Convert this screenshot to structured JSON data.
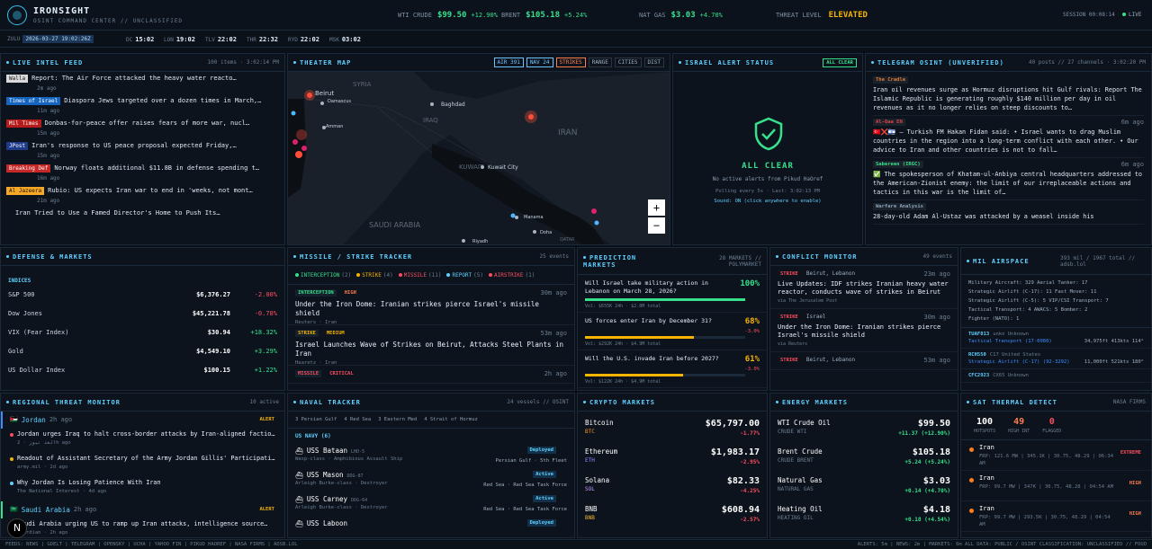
{
  "header": {
    "brand": "IRONSIGHT",
    "subtitle": "OSINT COMMAND CENTER // UNCLASSIFIED",
    "tickers": [
      {
        "label": "WTI CRUDE",
        "price": "$99.50",
        "chg": "+12.90%"
      },
      {
        "label": "BRENT",
        "price": "$105.18",
        "chg": "+5.24%"
      },
      {
        "label": "NAT GAS",
        "price": "$3.03",
        "chg": "+4.70%"
      }
    ],
    "threat_label": "THREAT LEVEL",
    "threat_value": "ELEVATED",
    "session": "SESSION 00:08:14",
    "live": "LIVE"
  },
  "clocks": {
    "zulu_label": "ZULU",
    "zulu": "2026-03-27 19:02:26Z",
    "items": [
      {
        "c": "DC",
        "t": "15:02"
      },
      {
        "c": "LON",
        "t": "19:02"
      },
      {
        "c": "TLV",
        "t": "22:02"
      },
      {
        "c": "THR",
        "t": "22:32"
      },
      {
        "c": "RYD",
        "t": "22:02"
      },
      {
        "c": "MSK",
        "t": "03:02"
      }
    ]
  },
  "feed": {
    "title": "LIVE INTEL FEED",
    "meta": "100 items · 3:02:14 PM",
    "items": [
      {
        "src": "Walla",
        "color": "#d9d9d9",
        "fg": "#111",
        "title": "Report: The Air Force attacked the heavy water reactor in A…",
        "time": "2m ago"
      },
      {
        "src": "Times of Israel",
        "color": "#1565c0",
        "fg": "#fff",
        "title": "Diaspora Jews targeted over a dozen times in March,…",
        "time": "11m ago"
      },
      {
        "src": "Mil Times",
        "color": "#b71c1c",
        "fg": "#fff",
        "title": "Donbas-for-peace offer raises fears of more war, nuclear…",
        "time": "15m ago"
      },
      {
        "src": "JPost",
        "color": "#1e3a8a",
        "fg": "#fff",
        "title": "Iran's response to US peace proposal expected Friday, sourc…",
        "time": "15m ago"
      },
      {
        "src": "Breaking Def",
        "color": "#c62828",
        "fg": "#fff",
        "title": "Norway floats additional $11.8B in defense spending th…",
        "time": "16m ago"
      },
      {
        "src": "Al Jazeera",
        "color": "#f9a825",
        "fg": "#111",
        "title": "Rubio: US expects Iran war to end in 'weeks, not months'",
        "time": "21m ago"
      },
      {
        "src": "",
        "color": "#0c131d",
        "fg": "#fff",
        "title": "Iran Tried to Use a Famed Director's Home to Push Its War Nar…",
        "time": ""
      }
    ]
  },
  "map": {
    "title": "THEATER MAP",
    "buttons": [
      "AIR 391",
      "NAV 24",
      "STRIKES",
      "RANGE",
      "CITIES",
      "DIST"
    ],
    "labels": [
      "SYRIA",
      "Beirut",
      "Damascus",
      "Amman",
      "Baghdad",
      "IRAQ",
      "IRAN",
      "KUWAIT",
      "Kuwait City",
      "SAUDI ARABIA",
      "Manama",
      "Doha",
      "Riyadh",
      "QATAR"
    ]
  },
  "alert": {
    "title": "ISRAEL ALERT STATUS",
    "badge": "ALL CLEAR",
    "status": "ALL CLEAR",
    "sub": "No active alerts from Pikud HaOref",
    "poll": "Polling every 5s · Last: 3:02:13 PM",
    "sound": "Sound: ON (click anywhere to enable)"
  },
  "telegram": {
    "title": "TELEGRAM OSINT (UNVERIFIED)",
    "meta": "40 posts // 27 channels · 3:02:20 PM",
    "items": [
      {
        "ch": "The Cradle",
        "ch_color": "#e37a2f",
        "text": "Iran oil revenues surge as Hormuz disruptions hit Gulf rivals: Report The Islamic Republic is generating roughly $140 million per day in oil revenues as it no longer relies on steep discounts to…",
        "time": ""
      },
      {
        "ch": "Al-Qaa EN",
        "ch_color": "#d84343",
        "text": "🇹🇷❌🇮🇱 — Turkish FM Hakan Fidan said: • Israel wants to drag Muslim countries in the region into a long-term conflict with each other. • Our advice to Iran and other countries is not to fall…",
        "time": "6m ago"
      },
      {
        "ch": "Sabereen (IRGC)",
        "ch_color": "#37e08b",
        "text": "✅ The spokesperson of Khatam-ul-Anbiya central headquarters addressed to the American-Zionist enemy: the limit of our irreplaceable actions and tactics in this war is the limit of…",
        "time": "6m ago"
      },
      {
        "ch": "Warfare Analysis",
        "ch_color": "#8aa1b9",
        "text": "28-day-old Adam Al-Ustaz was attacked by a weasel inside his",
        "time": ""
      }
    ]
  },
  "defense": {
    "title": "DEFENSE & MARKETS",
    "section": "INDICES",
    "rows": [
      {
        "n": "S&P 500",
        "v": "$6,376.27",
        "c": "-2.00%",
        "d": "down"
      },
      {
        "n": "Dow Jones",
        "v": "$45,221.78",
        "c": "-0.78%",
        "d": "down"
      },
      {
        "n": "VIX (Fear Index)",
        "v": "$30.94",
        "c": "+18.32%",
        "d": "up"
      },
      {
        "n": "Gold",
        "v": "$4,549.10",
        "c": "+3.29%",
        "d": "up"
      },
      {
        "n": "US Dollar Index",
        "v": "$100.15",
        "c": "+1.22%",
        "d": "up"
      }
    ]
  },
  "missile": {
    "title": "MISSILE / STRIKE TRACKER",
    "meta": "25 events",
    "chips": [
      {
        "l": "INTERCEPTION",
        "n": "(2)",
        "c": "#37e08b"
      },
      {
        "l": "STRIKE",
        "n": "(4)",
        "c": "#f5b400"
      },
      {
        "l": "MISSILE",
        "n": "(11)",
        "c": "#ff4d5e"
      },
      {
        "l": "REPORT",
        "n": "(5)",
        "c": "#5fd0ff"
      },
      {
        "l": "AIRSTRIKE",
        "n": "(1)",
        "c": "#ff4d5e"
      }
    ],
    "items": [
      {
        "tag": "INTERCEPTION",
        "tc": "#37e08b",
        "lvl": "HIGH",
        "lc": "#ff7d4d",
        "time": "30m ago",
        "title": "Under the Iron Dome: Iranian strikes pierce Israel's missile shield",
        "src": "Reuters · Iran"
      },
      {
        "tag": "STRIKE",
        "tc": "#f5b400",
        "lvl": "MEDIUM",
        "lc": "#f5b400",
        "time": "53m ago",
        "title": "Israel Launches Wave of Strikes on Beirut, Attacks Steel Plants in Iran",
        "src": "Haaretz · Iran"
      },
      {
        "tag": "MISSILE",
        "tc": "#ff4d5e",
        "lvl": "CRITICAL",
        "lc": "#ff4d5e",
        "time": "2h ago",
        "title": "",
        "src": ""
      }
    ]
  },
  "prediction": {
    "title": "PREDICTION MARKETS",
    "meta": "28 MARKETS // POLYMARKET",
    "items": [
      {
        "q": "Will Israel take military action in Lebanon on March 28, 2026?",
        "p": "100%",
        "v": "Vol: $655K 24h · $2.0M total",
        "pct": 100,
        "c": "#37e08b",
        "d": ""
      },
      {
        "q": "US forces enter Iran by December 31?",
        "p": "68%",
        "v": "Vol: $292K 24h · $4.9M total",
        "pct": 68,
        "c": "#f5b400",
        "d": "-3.0%"
      },
      {
        "q": "Will the U.S. invade Iran before 2027?",
        "p": "61%",
        "v": "Vol: $122K 24h · $4.9M total",
        "pct": 61,
        "c": "#f5b400",
        "d": "-3.0%"
      }
    ]
  },
  "conflict": {
    "title": "CONFLICT MONITOR",
    "meta": "49 events",
    "items": [
      {
        "tag": "STRIKE",
        "loc": "Beirut, Lebanon",
        "time": "23m ago",
        "title": "Live Updates: IDF strikes Iranian heavy water reactor, conducts wave of strikes in Beirut",
        "src": "via The Jerusalem Post"
      },
      {
        "tag": "STRIKE",
        "loc": "Israel",
        "time": "30m ago",
        "title": "Under the Iron Dome: Iranian strikes pierce Israel's missile shield",
        "src": "via Reuters"
      },
      {
        "tag": "STRIKE",
        "loc": "Beirut, Lebanon",
        "time": "53m ago",
        "title": "",
        "src": ""
      }
    ]
  },
  "airspace": {
    "title": "MIL AIRSPACE",
    "meta": "393 mil / 1967 total // adsb.lol",
    "lines": [
      "Military Aircraft: 329   Aerial Tanker: 17",
      "Strategic Airlift (C-17): 11   Fast Mover: 11",
      "Strategic Airlift (C-5): 5   VIP/CSI Transport: 7",
      "Tactical Transport: 4   AWACS: 5   Bomber: 2",
      "Fighter (NATO): 1"
    ],
    "flights": [
      {
        "cs": "TUAF813",
        "t": "Tactical Transport (17-0080)",
        "alt": "34,975ft 413kts 114°",
        "ty": "unkn Unknown"
      },
      {
        "cs": "RCH550",
        "t": "Strategic Airlift (C-17) (92-3292)",
        "alt": "11,000ft 521kts 180°",
        "ty": "C17 United States"
      },
      {
        "cs": "CFC2923",
        "t": "",
        "alt": "",
        "ty": "CX65 Unknown"
      }
    ]
  },
  "regional": {
    "title": "REGIONAL THREAT MONITOR",
    "meta": "10 active",
    "groups": [
      {
        "flag": "🇯🇴",
        "country": "Jordan",
        "time": "2h ago",
        "badge": "ALERT",
        "items": [
          {
            "t": "Jordan urges Iraq to halt cross-border attacks by Iran-aligned factions",
            "s": "الغد نيوز · 2h ago",
            "dot": "#ff4d5e"
          },
          {
            "t": "Readout of Assistant Secretary of the Army Jordan Gillis' Participatio…",
            "s": "army.mil · 2d ago",
            "dot": "#f5b400"
          },
          {
            "t": "Why Jordan Is Losing Patience With Iran",
            "s": "The National Interest · 4d ago",
            "dot": "#5fd0ff"
          }
        ]
      },
      {
        "flag": "🇸🇦",
        "country": "Saudi Arabia",
        "time": "2h ago",
        "badge": "ALERT",
        "items": [
          {
            "t": "Saudi Arabia urging US to ramp up Iran attacks, intelligence source…",
            "s": "Guardian · 2h ago",
            "dot": "#ff4d5e"
          }
        ]
      }
    ]
  },
  "naval": {
    "title": "NAVAL TRACKER",
    "meta": "24 vessels // OSINT",
    "filters": [
      "3 Persian Gulf",
      "4 Red Sea",
      "3 Eastern Med",
      "4 Strait of Hormuz"
    ],
    "section": "US NAVY (6)",
    "ships": [
      {
        "n": "USS Bataan",
        "h": "LHD-5",
        "c": "Wasp-class · Amphibious Assault Ship",
        "st": "Deployed",
        "loc": "Persian Gulf · 5th Fleet"
      },
      {
        "n": "USS Mason",
        "h": "DDG-87",
        "c": "Arleigh Burke-class · Destroyer",
        "st": "Active",
        "loc": "Red Sea · Red Sea Task Force"
      },
      {
        "n": "USS Carney",
        "h": "DDG-64",
        "c": "Arleigh Burke-class · Destroyer",
        "st": "Active",
        "loc": "Red Sea · Red Sea Task Force"
      },
      {
        "n": "USS Laboon",
        "h": "",
        "c": "",
        "st": "Deployed",
        "loc": ""
      }
    ]
  },
  "crypto": {
    "title": "CRYPTO MARKETS",
    "rows": [
      {
        "n": "Bitcoin",
        "s": "BTC",
        "p": "$65,797.00",
        "c": "-1.77%"
      },
      {
        "n": "Ethereum",
        "s": "ETH",
        "p": "$1,983.17",
        "c": "-2.95%"
      },
      {
        "n": "Solana",
        "s": "SOL",
        "p": "$82.33",
        "c": "-4.25%"
      },
      {
        "n": "BNB",
        "s": "BNB",
        "p": "$608.94",
        "c": "-2.57%"
      }
    ]
  },
  "energy": {
    "title": "ENERGY MARKETS",
    "rows": [
      {
        "n": "WTI Crude Oil",
        "s": "CRUDE WTI",
        "p": "$99.50",
        "c": "+11.37 (+12.90%)"
      },
      {
        "n": "Brent Crude",
        "s": "CRUDE BRENT",
        "p": "$105.18",
        "c": "+5.24 (+5.24%)"
      },
      {
        "n": "Natural Gas",
        "s": "NATURAL GAS",
        "p": "$3.03",
        "c": "+0.14 (+4.70%)"
      },
      {
        "n": "Heating Oil",
        "s": "HEATING OIL",
        "p": "$4.18",
        "c": "+0.18 (+4.54%)"
      }
    ]
  },
  "thermal": {
    "title": "SAT THERMAL DETECT",
    "meta": "NASA FIRMS",
    "stats": [
      {
        "v": "100",
        "l": "HOTSPOTS",
        "c": "#ffffff"
      },
      {
        "v": "49",
        "l": "HIGH INT",
        "c": "#ff7d4d"
      },
      {
        "v": "0",
        "l": "FLAGGED",
        "c": "#ff4d5e"
      }
    ],
    "items": [
      {
        "n": "Iran",
        "d": "FRP: 121.6 MW | 345.1K | 30.75, 48.29 | 06:34 AM",
        "tag": "EXTREME",
        "tc": "#ff4d5e"
      },
      {
        "n": "Iran",
        "d": "FRP: 99.7 MW | 347K | 30.75, 48.28 | 04:54 AM",
        "tag": "HIGH",
        "tc": "#ff7d4d"
      },
      {
        "n": "Iran",
        "d": "FRP: 99.7 MW | 293.5K | 30.75, 48.29 | 04:54 AM",
        "tag": "HIGH",
        "tc": "#ff7d4d"
      }
    ]
  },
  "footer": {
    "left": "FEEDS: NEWS | GDELT | TELEGRAM | OPENSKY | UCHA | YAHOO FIN | PIKUD HAOREF | NASA FIRMS | ADSB.LOL",
    "right": "ALERTS: 5m | NEWS: 2m | MARKETS: 6m   ALL DATA: PUBLIC / OSINT   CLASSIFICATION: UNCLASSIFIED // FOUO"
  }
}
